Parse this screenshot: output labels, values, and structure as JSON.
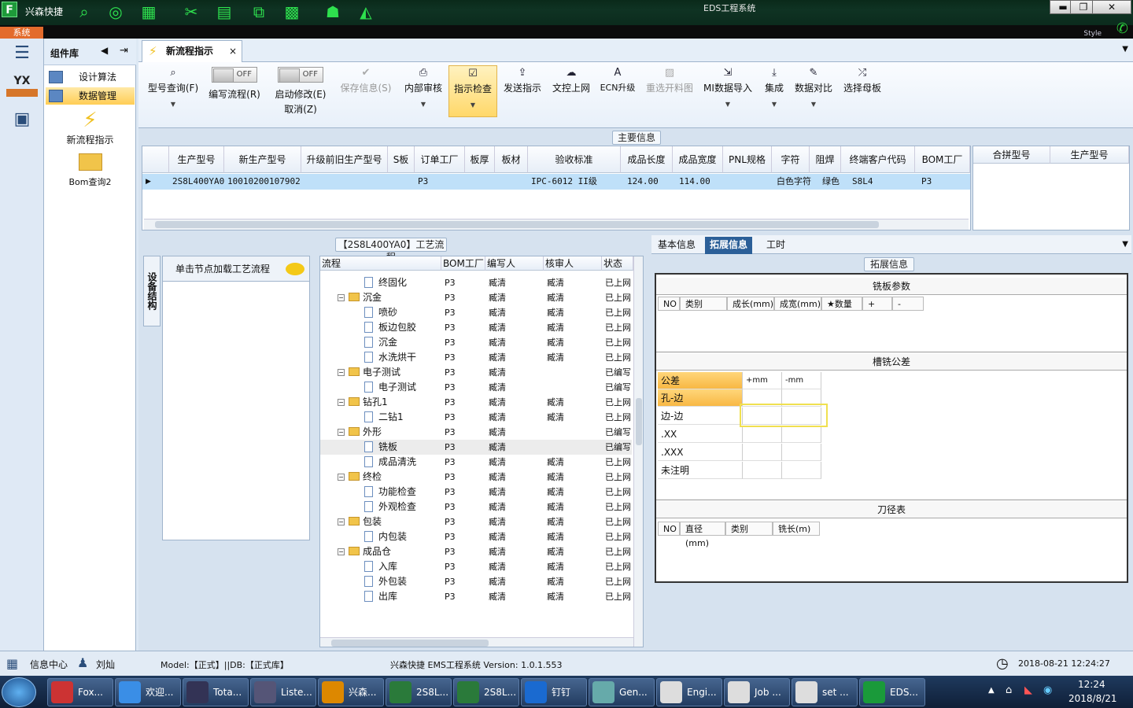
{
  "window": {
    "app_title": "兴森快捷",
    "title": "EDS工程系统",
    "style_label": "Style",
    "system_tab": "系统",
    "min": "▬",
    "max": "❐",
    "close": "✕"
  },
  "sidebar": {
    "header": "组件库",
    "items": [
      {
        "label": "设计算法"
      },
      {
        "label": "数据管理"
      }
    ],
    "big_items": [
      {
        "label": "新流程指示"
      },
      {
        "label": "Bom查询2"
      }
    ]
  },
  "tab": {
    "label": "新流程指示",
    "close": "×"
  },
  "toolbar": {
    "query": "型号查询(F)",
    "edit_flow": "编写流程(R)",
    "start_modify": "启动修改(E)",
    "cancel": "取消(Z)",
    "off": "OFF",
    "save": "保存信息(S)",
    "internal_review": "内部审核",
    "check": "指示检查",
    "send": "发送指示",
    "doc_upload": "文控上网",
    "ecn": "ECN升级",
    "reselect": "重选开料图",
    "mi_import": "MI数据导入",
    "integrate": "集成",
    "compare": "数据对比",
    "select_board": "选择母板"
  },
  "main_info": {
    "label": "主要信息",
    "headers": [
      "生产型号",
      "新生产型号",
      "升级前旧生产型号",
      "S板",
      "订单工厂",
      "板厚",
      "板材",
      "验收标准",
      "成品长度",
      "成品宽度",
      "PNL规格",
      "字符",
      "阻焊",
      "终端客户代码",
      "BOM工厂"
    ],
    "row": [
      "2S8L400YA0",
      "10010200107902",
      "",
      "",
      "P3",
      "",
      "",
      "IPC-6012 II级",
      "124.00",
      "114.00",
      "",
      "白色字符",
      "绿色",
      "S8L4",
      "P3"
    ],
    "side_headers": [
      "合拼型号",
      "生产型号"
    ]
  },
  "process": {
    "label": "【2S8L400YA0】工艺流程",
    "side_tab": "设备结构",
    "load_hint": "单击节点加载工艺流程",
    "headers": [
      "流程",
      "BOM工厂",
      "编写人",
      "核审人",
      "状态"
    ],
    "rows": [
      {
        "name": "终固化",
        "level": 2,
        "folder": false,
        "bom": "P3",
        "writer": "臧清",
        "reviewer": "臧清",
        "status": "已上网"
      },
      {
        "name": "沉金",
        "level": 1,
        "folder": true,
        "bom": "P3",
        "writer": "臧清",
        "reviewer": "臧清",
        "status": "已上网"
      },
      {
        "name": "喷砂",
        "level": 2,
        "folder": false,
        "bom": "P3",
        "writer": "臧清",
        "reviewer": "臧清",
        "status": "已上网"
      },
      {
        "name": "板边包胶",
        "level": 2,
        "folder": false,
        "bom": "P3",
        "writer": "臧清",
        "reviewer": "臧清",
        "status": "已上网"
      },
      {
        "name": "沉金",
        "level": 2,
        "folder": false,
        "bom": "P3",
        "writer": "臧清",
        "reviewer": "臧清",
        "status": "已上网"
      },
      {
        "name": "水洗烘干",
        "level": 2,
        "folder": false,
        "bom": "P3",
        "writer": "臧清",
        "reviewer": "臧清",
        "status": "已上网"
      },
      {
        "name": "电子测试",
        "level": 1,
        "folder": true,
        "bom": "P3",
        "writer": "臧清",
        "reviewer": "",
        "status": "已编写"
      },
      {
        "name": "电子测试",
        "level": 2,
        "folder": false,
        "bom": "P3",
        "writer": "臧清",
        "reviewer": "",
        "status": "已编写"
      },
      {
        "name": "钻孔1",
        "level": 1,
        "folder": true,
        "bom": "P3",
        "writer": "臧清",
        "reviewer": "臧清",
        "status": "已上网"
      },
      {
        "name": "二钻1",
        "level": 2,
        "folder": false,
        "bom": "P3",
        "writer": "臧清",
        "reviewer": "臧清",
        "status": "已上网"
      },
      {
        "name": "外形",
        "level": 1,
        "folder": true,
        "bom": "P3",
        "writer": "臧清",
        "reviewer": "",
        "status": "已编写"
      },
      {
        "name": "铣板",
        "level": 2,
        "folder": false,
        "bom": "P3",
        "writer": "臧清",
        "reviewer": "",
        "status": "已编写"
      },
      {
        "name": "成品清洗",
        "level": 2,
        "folder": false,
        "bom": "P3",
        "writer": "臧清",
        "reviewer": "臧清",
        "status": "已上网"
      },
      {
        "name": "终检",
        "level": 1,
        "folder": true,
        "bom": "P3",
        "writer": "臧清",
        "reviewer": "臧清",
        "status": "已上网"
      },
      {
        "name": "功能检查",
        "level": 2,
        "folder": false,
        "bom": "P3",
        "writer": "臧清",
        "reviewer": "臧清",
        "status": "已上网"
      },
      {
        "name": "外观检查",
        "level": 2,
        "folder": false,
        "bom": "P3",
        "writer": "臧清",
        "reviewer": "臧清",
        "status": "已上网"
      },
      {
        "name": "包装",
        "level": 1,
        "folder": true,
        "bom": "P3",
        "writer": "臧清",
        "reviewer": "臧清",
        "status": "已上网"
      },
      {
        "name": "内包装",
        "level": 2,
        "folder": false,
        "bom": "P3",
        "writer": "臧清",
        "reviewer": "臧清",
        "status": "已上网"
      },
      {
        "name": "成品仓",
        "level": 1,
        "folder": true,
        "bom": "P3",
        "writer": "臧清",
        "reviewer": "臧清",
        "status": "已上网"
      },
      {
        "name": "入库",
        "level": 2,
        "folder": false,
        "bom": "P3",
        "writer": "臧清",
        "reviewer": "臧清",
        "status": "已上网"
      },
      {
        "name": "外包装",
        "level": 2,
        "folder": false,
        "bom": "P3",
        "writer": "臧清",
        "reviewer": "臧清",
        "status": "已上网"
      },
      {
        "name": "出库",
        "level": 2,
        "folder": false,
        "bom": "P3",
        "writer": "臧清",
        "reviewer": "臧清",
        "status": "已上网"
      }
    ],
    "selected_index": 11
  },
  "right": {
    "tabs": [
      "基本信息",
      "拓展信息",
      "工时"
    ],
    "ext_label": "拓展信息",
    "steel": {
      "title": "铣板参数",
      "headers": [
        "NO",
        "类别",
        "成长(mm)",
        "成宽(mm)",
        "★数量",
        "+",
        "-"
      ]
    },
    "tol": {
      "title": "槽铣公差",
      "header": "公差",
      "plus": "+mm",
      "minus": "-mm",
      "rows": [
        "孔-边",
        "边-边",
        ".XX",
        ".XXX",
        "未注明"
      ]
    },
    "knife": {
      "title": "刀径表",
      "headers": [
        "NO",
        "直径(mm)",
        "类别",
        "铣长(m)"
      ]
    }
  },
  "status": {
    "info": "信息中心",
    "user": "刘灿",
    "model": "Model:【正式】||DB:【正式库】",
    "version": "兴森快捷 EMS工程系统 Version: 1.0.1.553",
    "datetime": "2018-08-21 12:24:27"
  },
  "taskbar": {
    "items": [
      "Fox...",
      "欢迎...",
      "Tota...",
      "Liste...",
      "兴森...",
      "2S8L...",
      "2S8L...",
      "钉钉",
      "Gen...",
      "Engi...",
      "Job ...",
      "set ...",
      "EDS..."
    ],
    "time": "12:24",
    "date": "2018/8/21"
  }
}
